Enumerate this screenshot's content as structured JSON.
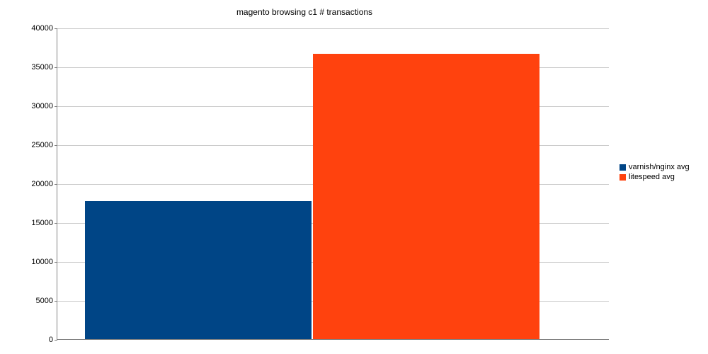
{
  "chart_data": {
    "type": "bar",
    "title": "magento browsing c1 # transactions",
    "xlabel": "",
    "ylabel": "",
    "ylim": [
      0,
      40000
    ],
    "yticks": [
      0,
      5000,
      10000,
      15000,
      20000,
      25000,
      30000,
      35000,
      40000
    ],
    "series": [
      {
        "name": "varnish/nginx avg",
        "color": "#004586",
        "values": [
          17700
        ]
      },
      {
        "name": "litespeed avg",
        "color": "#ff420e",
        "values": [
          36600
        ]
      }
    ],
    "categories": [
      ""
    ]
  }
}
